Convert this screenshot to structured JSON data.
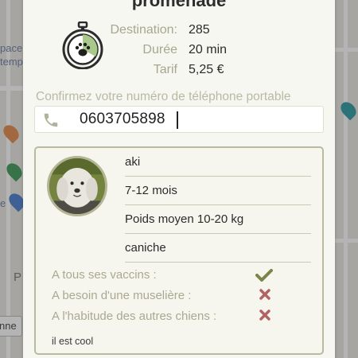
{
  "colors": {
    "accent_green": "#a9c98c",
    "olive": "#6e7a3e",
    "check": "#7a8547",
    "cross": "#b06464"
  },
  "map": {
    "texts": [
      "pace",
      "temp",
      "e",
      "P",
      "nne"
    ],
    "icons": [
      "restaurant-pin-icon",
      "tree-pin-icon",
      "location-pin-icon",
      "accessibility-pin-icon"
    ]
  },
  "modal": {
    "title": "promenade",
    "stopwatch_icon": "paw-stopwatch-icon",
    "info": [
      {
        "label": "Destination:",
        "value": "285"
      },
      {
        "label": "Durée",
        "value": "20 min"
      },
      {
        "label": "Tarif",
        "value": "5,25 €"
      }
    ],
    "phone": {
      "label": "Confirmez votre numéro de téléphone portable",
      "value": "0603705898",
      "icon": "phone-icon"
    },
    "dog": {
      "name": "aki",
      "age": "7-12 mois",
      "weight": "Poids moyen 10-20 kg",
      "breed": "caniche",
      "questions": [
        {
          "label": "A tous ses vaccins :",
          "answer": "yes",
          "icon": "check-icon"
        },
        {
          "label": "A besoin d'une muselière :",
          "answer": "no",
          "icon": "cross-icon"
        },
        {
          "label": "A l'habitude des autres chiens :",
          "answer": "no",
          "icon": "cross-icon"
        }
      ],
      "comment": "il est cool"
    }
  }
}
